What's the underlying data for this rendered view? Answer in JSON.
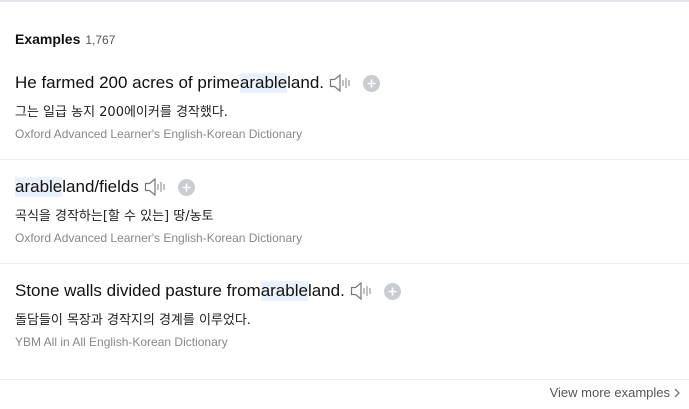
{
  "header": {
    "title": "Examples",
    "count": "1,767"
  },
  "examples": [
    {
      "sentence_before": "He farmed 200 acres of prime ",
      "keyword": "arable",
      "sentence_after": " land.",
      "translation": "그는 일급 농지 200에이커를 경작했다.",
      "source": "Oxford Advanced Learner's English-Korean Dictionary"
    },
    {
      "sentence_before": "",
      "keyword": "arable",
      "sentence_after": " land/fields",
      "translation": "곡식을 경작하는[할 수 있는] 땅/농토",
      "source": "Oxford Advanced Learner's English-Korean Dictionary"
    },
    {
      "sentence_before": "Stone walls divided pasture from ",
      "keyword": "arable",
      "sentence_after": " land.",
      "translation": "돌담들이 목장과 경작지의 경계를 이루었다.",
      "source": "YBM All in All English-Korean Dictionary"
    }
  ],
  "footer": {
    "view_more": "View more examples"
  },
  "icons": {
    "speaker": "speaker-icon",
    "add": "plus-icon",
    "chevron": "chevron-right-icon"
  },
  "colors": {
    "highlight": "#e9f2fc",
    "icon_gray": "#c9ccd1"
  }
}
